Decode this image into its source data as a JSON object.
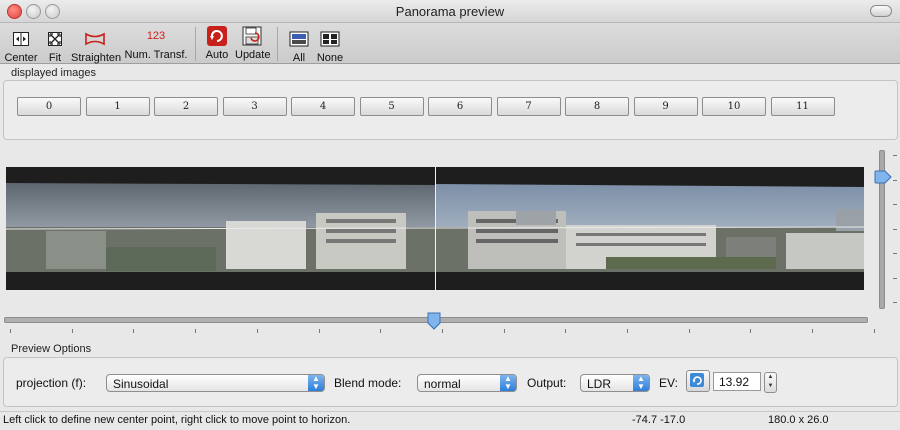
{
  "window": {
    "title": "Panorama preview"
  },
  "toolbar": {
    "center": "Center",
    "fit": "Fit",
    "straighten": "Straighten",
    "num_transf": "Num. Transf.",
    "num_transf_icon_text": "123",
    "auto": "Auto",
    "update": "Update",
    "all": "All",
    "none": "None"
  },
  "displayed_images": {
    "label": "displayed images",
    "buttons": [
      "0",
      "1",
      "2",
      "3",
      "4",
      "5",
      "6",
      "7",
      "8",
      "9",
      "10",
      "11"
    ]
  },
  "preview_options": {
    "label": "Preview Options",
    "projection_label": "projection (f):",
    "projection_value": "Sinusoidal",
    "blend_label": "Blend mode:",
    "blend_value": "normal",
    "output_label": "Output:",
    "output_value": "LDR",
    "ev_label": "EV:",
    "ev_value": "13.92"
  },
  "status": {
    "hint": "Left click to define new center point, right click to move point to horizon.",
    "coords": "-74.7 -17.0",
    "fov": "180.0 x 26.0"
  },
  "colors": {
    "accent": "#2f7ed8",
    "preview_bg": "#1e1e1e",
    "close": "#e0443a"
  }
}
